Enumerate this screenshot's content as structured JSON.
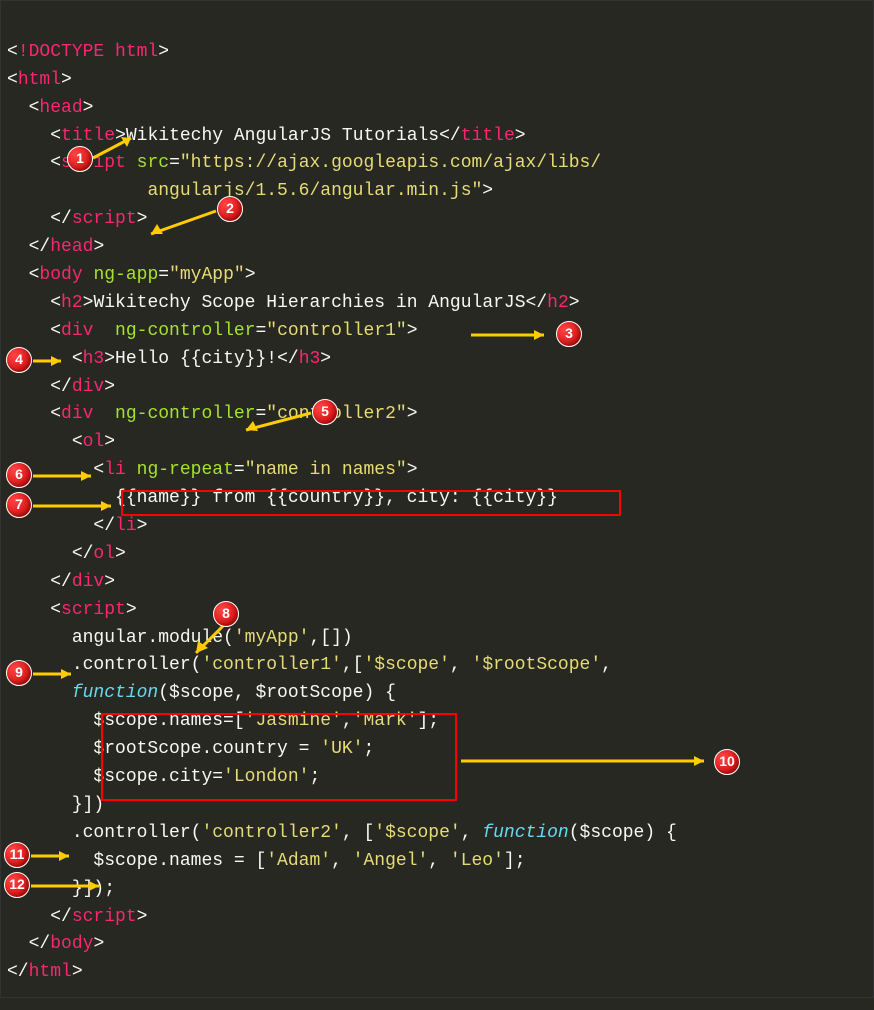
{
  "badges": {
    "b1": "1",
    "b2": "2",
    "b3": "3",
    "b4": "4",
    "b5": "5",
    "b6": "6",
    "b7": "7",
    "b8": "8",
    "b9": "9",
    "b10": "10",
    "b11": "11",
    "b12": "12"
  },
  "code": {
    "l1_doctype": "!DOCTYPE html",
    "l2_html": "html",
    "l3_head": "head",
    "l4_title": "title",
    "l4_text": "Wikitechy AngularJS Tutorials",
    "l4_title_c": "title",
    "l5_script": "script",
    "l5_src": "src",
    "l5_srcval": "\"https://ajax.googleapis.com/ajax/libs/",
    "l6_srcval2": "angularjs/1.5.6/angular.min.js\"",
    "l7_script_c": "script",
    "l8_head_c": "head",
    "l9_body": "body",
    "l9_ngapp": "ng-app",
    "l9_ngapp_v": "\"myApp\"",
    "l10_h2": "h2",
    "l10_text": "Wikitechy Scope Hierarchies in AngularJS",
    "l10_h2_c": "h2",
    "l11_div": "div",
    "l11_ngc": "ng-controller",
    "l11_ngc_v": "\"controller1\"",
    "l12_h3": "h3",
    "l12_text": "Hello {{city}}!",
    "l12_h3_c": "h3",
    "l13_div_c": "div",
    "l14_div": "div",
    "l14_ngc": "ng-controller",
    "l14_ngc_v": "\"controller2\"",
    "l15_ol": "ol",
    "l16_li": "li",
    "l16_ngr": "ng-repeat",
    "l16_ngr_v": "\"name in names\"",
    "l17_text": "{{name}} from {{country}}, city: {{city}}",
    "l18_li_c": "li",
    "l19_ol_c": "ol",
    "l20_div_c": "div",
    "l21_script": "script",
    "l22_text": "angular.module(",
    "l22_s1": "'myApp'",
    "l22_text2": ",[])",
    "l23_text": ".controller(",
    "l23_s1": "'controller1'",
    "l23_text2": ",[",
    "l23_s2": "'$scope'",
    "l23_text3": ", ",
    "l23_s3": "'$rootScope'",
    "l23_text4": ",",
    "l24_func": "function",
    "l24_text": "($scope, $rootScope) {",
    "l25_text": "$scope.names=[",
    "l25_s1": "'Jasmine'",
    "l25_c": ",",
    "l25_s2": "'Mark'",
    "l25_text2": "];",
    "l26_text": "$rootScope.country = ",
    "l26_s1": "'UK'",
    "l26_text2": ";",
    "l27_text": "$scope.city=",
    "l27_s1": "'London'",
    "l27_text2": ";",
    "l28_text": "}])",
    "l29_text": ".controller(",
    "l29_s1": "'controller2'",
    "l29_text2": ", [",
    "l29_s2": "'$scope'",
    "l29_text3": ", ",
    "l29_func": "function",
    "l29_text4": "($scope) {",
    "l30_text": "$scope.names = [",
    "l30_s1": "'Adam'",
    "l30_c1": ", ",
    "l30_s2": "'Angel'",
    "l30_c2": ", ",
    "l30_s3": "'Leo'",
    "l30_text2": "];",
    "l31_text": "}]);",
    "l32_script_c": "script",
    "l33_body_c": "body",
    "l34_html_c": "html"
  }
}
